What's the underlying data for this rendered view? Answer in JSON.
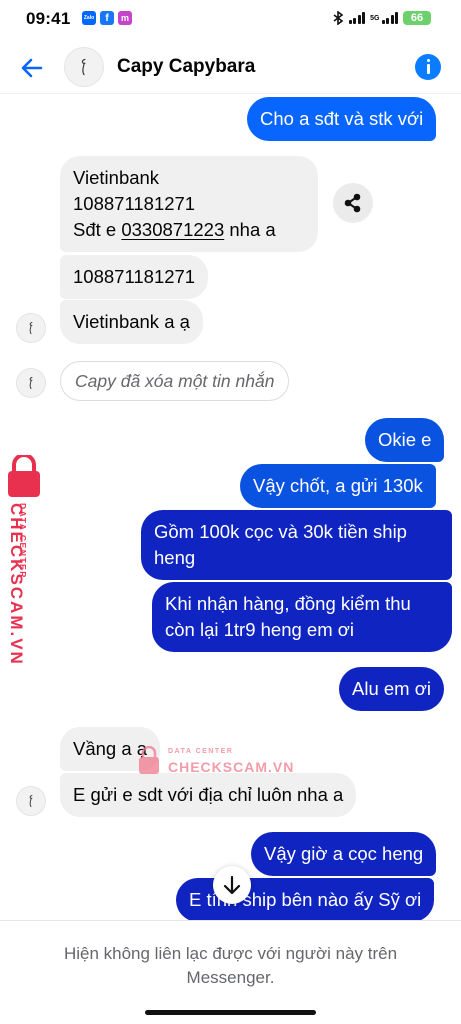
{
  "status_bar": {
    "time": "09:41",
    "app_badges": [
      {
        "label": "Zalo",
        "color": "#0068ff"
      },
      {
        "label": "f",
        "color": "#1877f2"
      },
      {
        "label": "m",
        "color": "#c644c9"
      }
    ],
    "network": "5G",
    "battery": "66"
  },
  "header": {
    "contact_name": "Capy Capybara",
    "back_icon": "back-arrow-icon",
    "info_icon": "info-icon"
  },
  "messages": {
    "m1": "Cho a sđt và stk với",
    "m2_line1": "Vietinbank",
    "m2_line2": "108871181271",
    "m2_line3_prefix": "Sđt e ",
    "m2_phone": "0330871223",
    "m2_line3_suffix": " nha a",
    "m3": "108871181271",
    "m4": "Vietinbank a ạ",
    "deleted": "Capy đã xóa một tin nhắn",
    "m5": "Okie e",
    "m6": "Vậy chốt, a gửi 130k",
    "m7_line1": "Gồm 100k cọc và 30k tiền ship",
    "m7_line2": "heng",
    "m8_line1": "Khi nhận hàng, đồng kiểm thu",
    "m8_line2": "còn lại 1tr9 heng em ơi",
    "m9": "Alu em ơi",
    "m10": "Vầng a ạ",
    "m11": "E gửi e sdt với địa chỉ luôn nha a",
    "m12": "Vậy giờ a cọc heng",
    "m13": "E tính ship bên nào ấy Sỹ ơi"
  },
  "watermark": {
    "line1": "DATA CENTER",
    "line2": "CHECKSCAM.VN",
    "color": "#e8314f"
  },
  "footer": {
    "notice": "Hiện không liên lạc được với người này trên Messenger."
  },
  "colors": {
    "accent": "#0866ff",
    "incoming_bg": "#f0f0f0",
    "outgoing_dark": "#1024c2"
  }
}
